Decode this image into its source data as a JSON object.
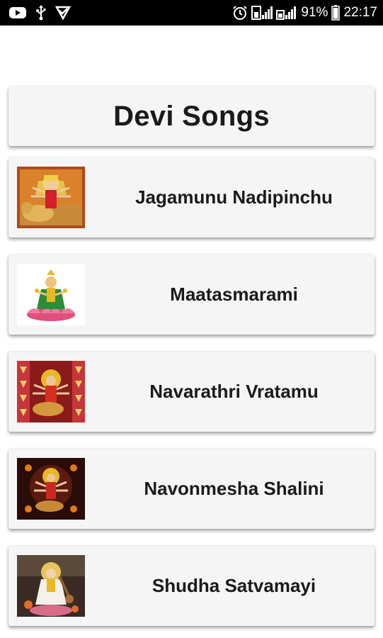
{
  "status_bar": {
    "icons_left": [
      "youtube-icon",
      "usb-icon",
      "download-check-icon"
    ],
    "icons_right": [
      "alarm-icon",
      "signal-icon",
      "signal-icon",
      "battery-icon"
    ],
    "battery_level": "91%",
    "time": "22:17"
  },
  "header": {
    "title": "Devi Songs"
  },
  "songs": [
    {
      "title": "Jagamunu Nadipinchu",
      "thumbnail": "durga-on-lion-image"
    },
    {
      "title": "Maatasmarami",
      "thumbnail": "lakshmi-on-lotus-image"
    },
    {
      "title": "Navarathri Vratamu",
      "thumbnail": "durga-red-frame-image"
    },
    {
      "title": "Navonmesha Shalini",
      "thumbnail": "durga-dark-frame-image"
    },
    {
      "title": "Shudha Satvamayi",
      "thumbnail": "saraswati-image"
    }
  ]
}
